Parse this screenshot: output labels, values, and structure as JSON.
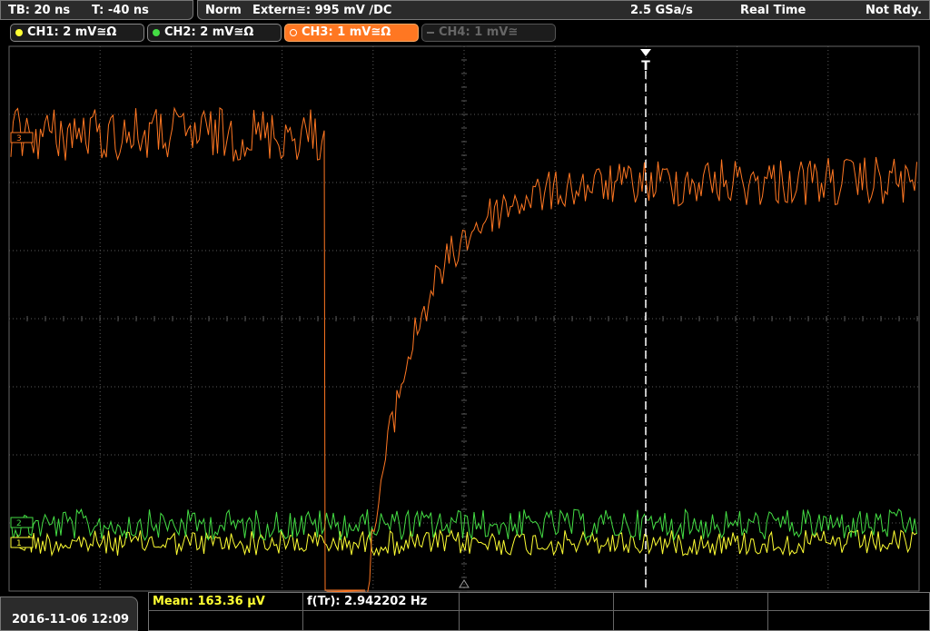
{
  "status": {
    "timebase": "TB: 20 ns",
    "trigger_offset": "T: -40 ns",
    "trigger_mode": "Norm",
    "trigger_source": "Extern≅: 995 mV ∕DC",
    "sample_rate": "2.5 GSa/s",
    "acq_mode": "Real Time",
    "ready_state": "Not Rdy."
  },
  "channels": [
    {
      "label": "CH1: 2 mV≅Ω",
      "color": "#ffff33",
      "active": true
    },
    {
      "label": "CH2: 2 mV≅Ω",
      "color": "#44dd44",
      "active": true
    },
    {
      "label": "CH3: 1 mV≅Ω",
      "color": "#ff7722",
      "active": true,
      "selected": true
    },
    {
      "label": "CH4: 1 mV≅",
      "color": "#666666",
      "active": false
    }
  ],
  "trace_markers": {
    "ch3": "3",
    "ch2": "2",
    "ch1": "1"
  },
  "trigger_marker": "T",
  "footer": {
    "datetime": "2016-11-06 12:09",
    "mean": "Mean: 163.36 µV",
    "freq": "f(Tr): 2.942202 Hz"
  },
  "colors": {
    "ch1": "#ffff33",
    "ch2": "#44dd44",
    "ch3": "#ff7722",
    "grid": "#5a5a5a",
    "panel": "#2b2b2b",
    "selected_tab": "#ff7722"
  }
}
